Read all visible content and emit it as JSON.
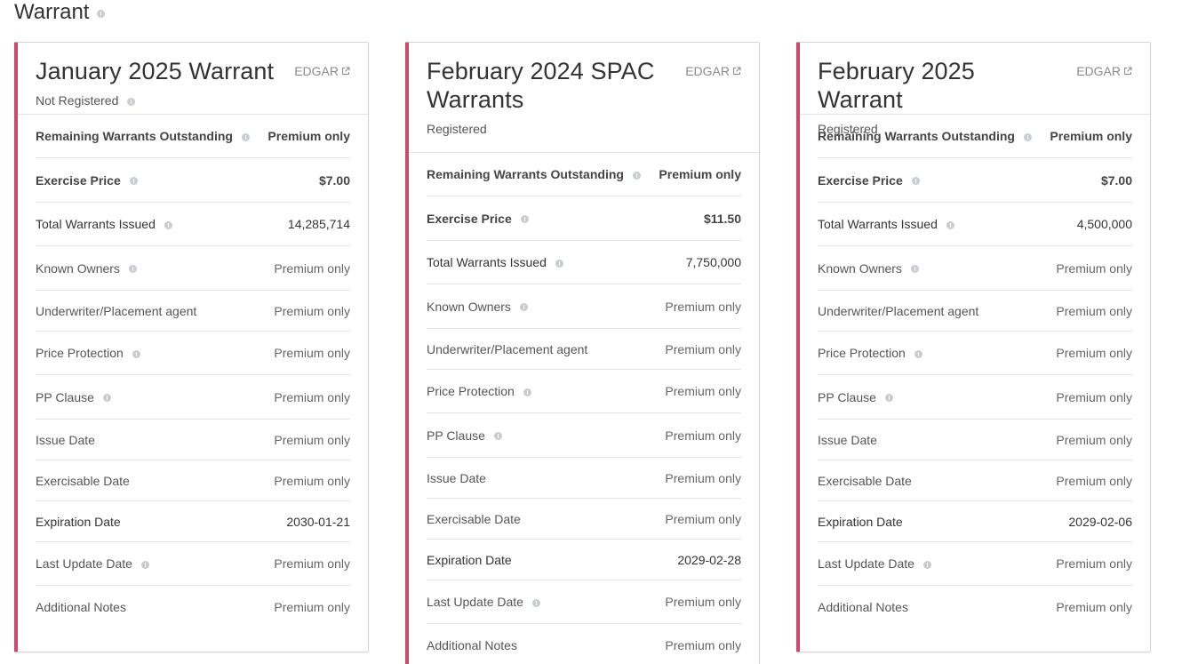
{
  "section": {
    "title": "Warrant"
  },
  "cards": [
    {
      "title": "January 2025 Warrant",
      "status": "Not Registered",
      "edgar_label": "EDGAR",
      "rows": [
        {
          "label": "Remaining Warrants Outstanding",
          "value": "Premium only"
        },
        {
          "label": "Exercise Price",
          "value": "$7.00"
        },
        {
          "label": "Total Warrants Issued",
          "value": "14,285,714"
        },
        {
          "label": "Known Owners",
          "value": "Premium only"
        },
        {
          "label": "Underwriter/Placement agent",
          "value": "Premium only"
        },
        {
          "label": "Price Protection",
          "value": "Premium only"
        },
        {
          "label": "PP Clause",
          "value": "Premium only"
        },
        {
          "label": "Issue Date",
          "value": "Premium only"
        },
        {
          "label": "Exercisable Date",
          "value": "Premium only"
        },
        {
          "label": "Expiration Date",
          "value": "2030-01-21"
        },
        {
          "label": "Last Update Date",
          "value": "Premium only"
        },
        {
          "label": "Additional Notes",
          "value": "Premium only"
        }
      ]
    },
    {
      "title": "February 2024 SPAC Warrants",
      "status": "Registered",
      "edgar_label": "EDGAR",
      "rows": [
        {
          "label": "Remaining Warrants Outstanding",
          "value": "Premium only"
        },
        {
          "label": "Exercise Price",
          "value": "$11.50"
        },
        {
          "label": "Total Warrants Issued",
          "value": "7,750,000"
        },
        {
          "label": "Known Owners",
          "value": "Premium only"
        },
        {
          "label": "Underwriter/Placement agent",
          "value": "Premium only"
        },
        {
          "label": "Price Protection",
          "value": "Premium only"
        },
        {
          "label": "PP Clause",
          "value": "Premium only"
        },
        {
          "label": "Issue Date",
          "value": "Premium only"
        },
        {
          "label": "Exercisable Date",
          "value": "Premium only"
        },
        {
          "label": "Expiration Date",
          "value": "2029-02-28"
        },
        {
          "label": "Last Update Date",
          "value": "Premium only"
        },
        {
          "label": "Additional Notes",
          "value": "Premium only"
        }
      ]
    },
    {
      "title": "February 2025 Warrant",
      "status": "Registered",
      "edgar_label": "EDGAR",
      "rows": [
        {
          "label": "Remaining Warrants Outstanding",
          "value": "Premium only"
        },
        {
          "label": "Exercise Price",
          "value": "$7.00"
        },
        {
          "label": "Total Warrants Issued",
          "value": "4,500,000"
        },
        {
          "label": "Known Owners",
          "value": "Premium only"
        },
        {
          "label": "Underwriter/Placement agent",
          "value": "Premium only"
        },
        {
          "label": "Price Protection",
          "value": "Premium only"
        },
        {
          "label": "PP Clause",
          "value": "Premium only"
        },
        {
          "label": "Issue Date",
          "value": "Premium only"
        },
        {
          "label": "Exercisable Date",
          "value": "Premium only"
        },
        {
          "label": "Expiration Date",
          "value": "2029-02-06"
        },
        {
          "label": "Last Update Date",
          "value": "Premium only"
        },
        {
          "label": "Additional Notes",
          "value": "Premium only"
        }
      ]
    }
  ],
  "colors": {
    "accent": "#c94a6a",
    "border": "#d4d4d4",
    "divider": "#e5e5e5",
    "info_icon": "#c8ccd1"
  }
}
